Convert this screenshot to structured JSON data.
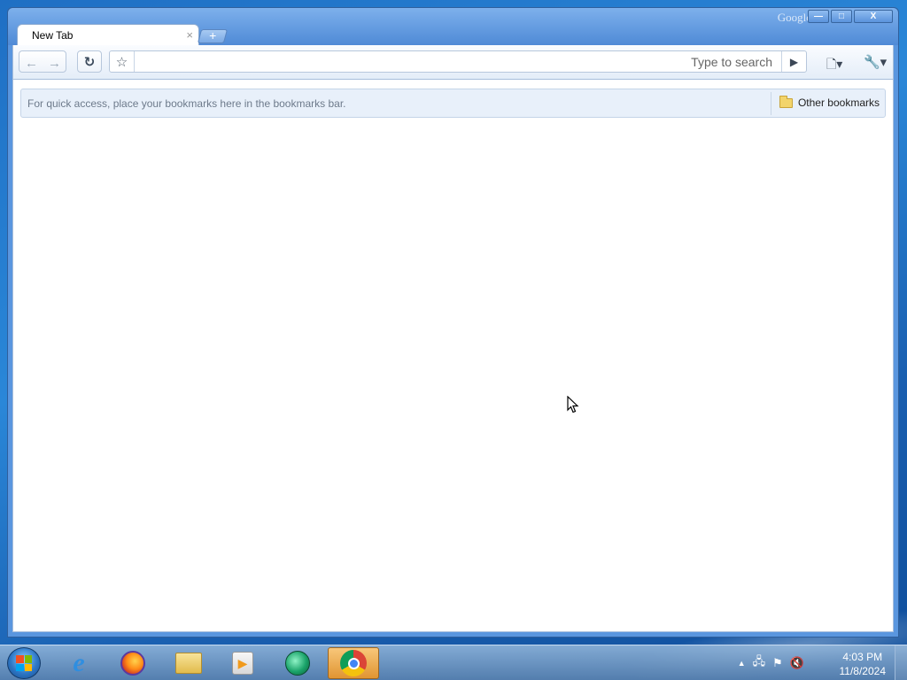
{
  "window": {
    "brand": "Google",
    "controls": {
      "minimize": "—",
      "maximize": "□",
      "close": "X"
    }
  },
  "tabs": [
    {
      "title": "New Tab",
      "close": "×"
    }
  ],
  "new_tab_button": "+",
  "toolbar": {
    "back": "←",
    "forward": "→",
    "reload": "↻",
    "star": "☆",
    "omnibox": {
      "value": "",
      "placeholder": "Type to search"
    },
    "go": "▶",
    "page_menu": "🗋▾",
    "wrench_menu": "🔧▾"
  },
  "bookmarks_bar": {
    "hint": "For quick access, place your bookmarks here in the bookmarks bar.",
    "other_bookmarks": "Other bookmarks"
  },
  "taskbar": {
    "apps": [
      {
        "name": "internet-explorer",
        "glyph": "e"
      },
      {
        "name": "firefox",
        "glyph": ""
      },
      {
        "name": "windows-explorer",
        "glyph": ""
      },
      {
        "name": "media-player",
        "glyph": "▶"
      },
      {
        "name": "green-app",
        "glyph": ""
      },
      {
        "name": "chrome",
        "glyph": "",
        "active": true
      }
    ],
    "tray": {
      "expand": "▲",
      "network": "🖧",
      "flag": "⚑",
      "volume": "🔇"
    },
    "clock": {
      "time": "4:03 PM",
      "date": "11/8/2024"
    }
  },
  "colors": {
    "window_frame": "#5a96df",
    "bookmarks_bar_bg": "#e8f0fa",
    "chrome_active_taskbar": "#e09532"
  }
}
